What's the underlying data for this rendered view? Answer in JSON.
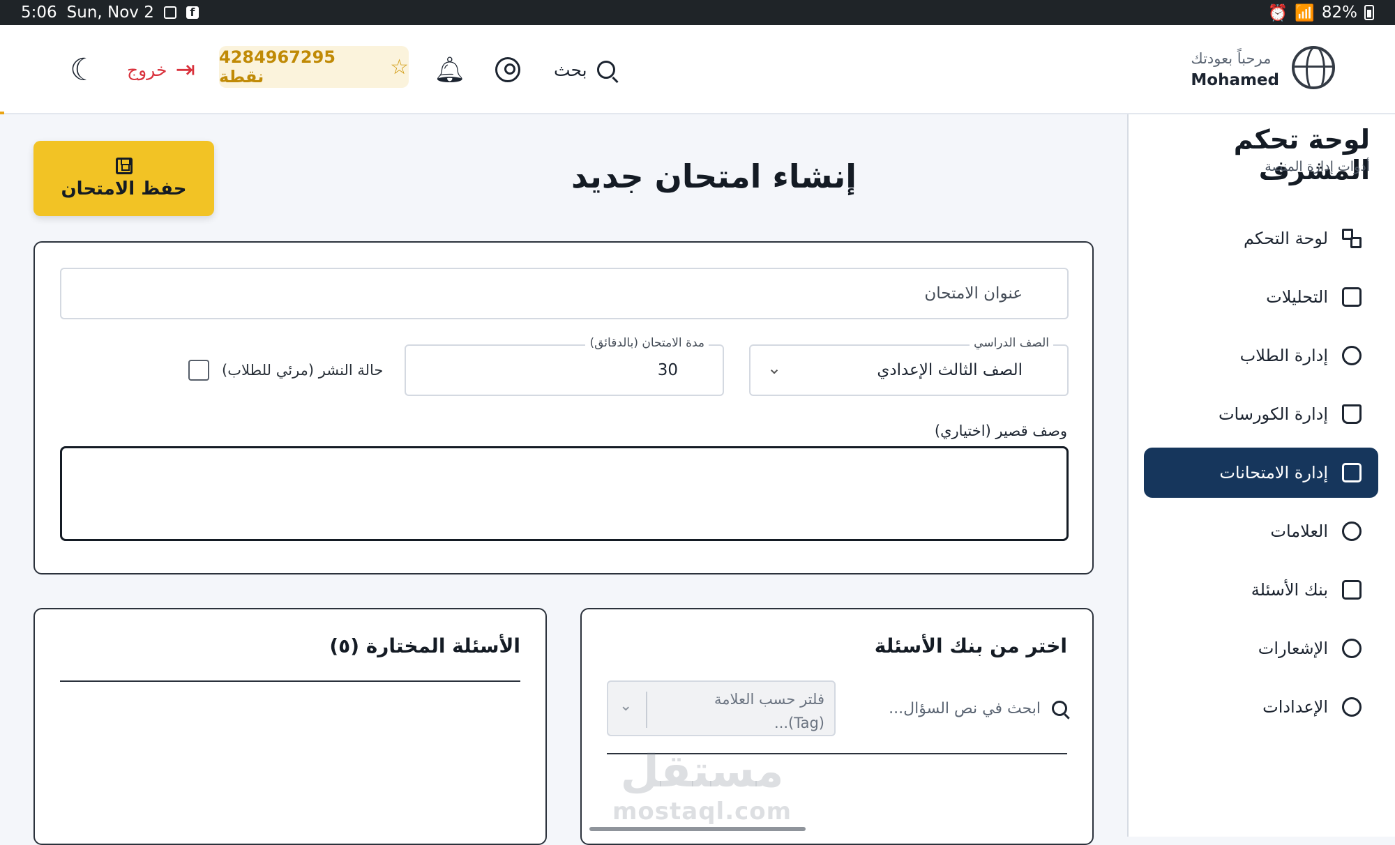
{
  "status_bar": {
    "time": "5:06",
    "date": "Sun, Nov 2",
    "battery": "82%"
  },
  "header": {
    "logout_label": "خروج",
    "points_label": "4284967295 نقطة",
    "search_label": "بحث",
    "welcome_text": "مرحباً بعودتك",
    "user_name": "Mohamed"
  },
  "sidebar": {
    "title": "لوحة تحكم المشرف",
    "subtitle": "أدوات إدارة المنصة",
    "items": [
      {
        "label": "لوحة التحكم",
        "icon": "dashboard-grid-icon"
      },
      {
        "label": "التحليلات",
        "icon": "bar-chart-icon"
      },
      {
        "label": "إدارة الطلاب",
        "icon": "users-icon"
      },
      {
        "label": "إدارة الكورسات",
        "icon": "book-icon"
      },
      {
        "label": "إدارة الامتحانات",
        "icon": "document-icon",
        "active": true
      },
      {
        "label": "العلامات",
        "icon": "tag-icon"
      },
      {
        "label": "بنك الأسئلة",
        "icon": "money-bill-icon"
      },
      {
        "label": "الإشعارات",
        "icon": "bell-icon"
      },
      {
        "label": "الإعدادات",
        "icon": "gear-icon"
      }
    ]
  },
  "main": {
    "page_title": "إنشاء امتحان جديد",
    "save_button": "حفظ الامتحان",
    "form": {
      "title_placeholder": "عنوان الامتحان",
      "grade_label": "الصف الدراسي",
      "grade_value": "الصف الثالث الإعدادي",
      "duration_label": "مدة الامتحان (بالدقائق)",
      "duration_value": "30",
      "publish_label": "حالة النشر (مرئي للطلاب)",
      "description_label": "وصف قصير (اختياري)"
    },
    "bank": {
      "title": "اختر من بنك الأسئلة",
      "search_placeholder": "ابحث في نص السؤال...",
      "tag_filter_placeholder": "فلتر حسب العلامة (Tag)..."
    },
    "selected": {
      "title": "الأسئلة المختارة (٥)"
    }
  },
  "watermark": {
    "line1": "مستقل",
    "line2": "mostaql.com"
  },
  "colors": {
    "accent": "#f2c325",
    "active_nav": "#16365c",
    "logout": "#d9313c",
    "points": "#c08a06"
  }
}
